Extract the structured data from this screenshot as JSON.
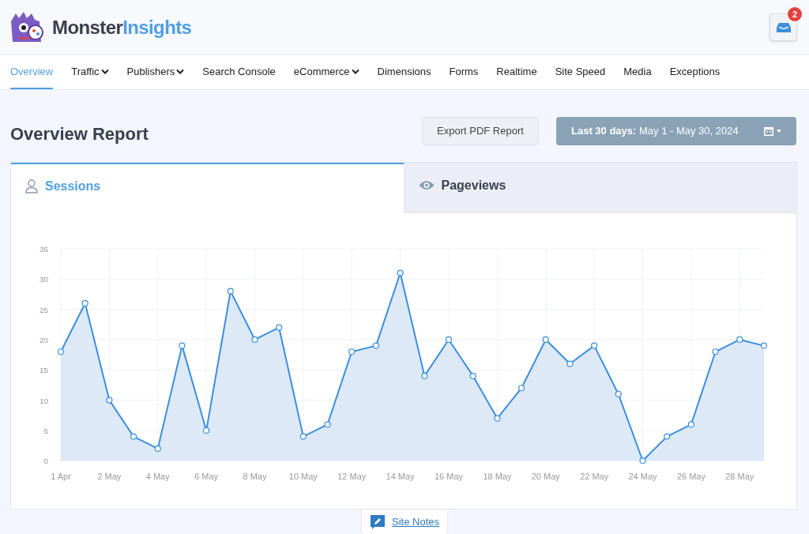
{
  "header": {
    "logo": {
      "first": "Monster",
      "second": "Insights"
    },
    "notifications": {
      "count": "2"
    }
  },
  "nav": [
    {
      "label": "Overview",
      "selected": true,
      "dropdown": false
    },
    {
      "label": "Traffic",
      "selected": false,
      "dropdown": true
    },
    {
      "label": "Publishers",
      "selected": false,
      "dropdown": true
    },
    {
      "label": "Search Console",
      "selected": false,
      "dropdown": false
    },
    {
      "label": "eCommerce",
      "selected": false,
      "dropdown": true
    },
    {
      "label": "Dimensions",
      "selected": false,
      "dropdown": false
    },
    {
      "label": "Forms",
      "selected": false,
      "dropdown": false
    },
    {
      "label": "Realtime",
      "selected": false,
      "dropdown": false
    },
    {
      "label": "Site Speed",
      "selected": false,
      "dropdown": false
    },
    {
      "label": "Media",
      "selected": false,
      "dropdown": false
    },
    {
      "label": "Exceptions",
      "selected": false,
      "dropdown": false
    }
  ],
  "report": {
    "title": "Overview Report",
    "export_button": "Export PDF Report",
    "date_range": "**Last 30 days:** May 1 - May 30, 2024"
  },
  "tabs": [
    {
      "label": "Sessions",
      "kind": "user",
      "selected": true
    },
    {
      "label": "Pageviews",
      "kind": "eye",
      "selected": false
    }
  ],
  "chart_data": {
    "type": "area",
    "ylim": [
      0,
      35
    ],
    "yticks": [
      0,
      5,
      10,
      15,
      20,
      25,
      30,
      35
    ],
    "grid": true,
    "categories": [
      "1 Apr",
      null,
      "2 May",
      null,
      "4 May",
      null,
      "6 May",
      null,
      "8 May",
      null,
      "10 May",
      null,
      "12 May",
      null,
      "14 May",
      null,
      "16 May",
      null,
      "18 May",
      null,
      "20 May",
      null,
      "22 May",
      null,
      "24 May",
      null,
      "26 May",
      null,
      "28 May",
      null
    ],
    "series": [
      {
        "color": "#3b8fdc",
        "values": [
          18,
          26,
          10,
          4,
          2,
          19,
          5,
          28,
          20,
          22,
          4,
          6,
          18,
          19,
          31,
          14,
          20,
          14,
          7,
          12,
          20,
          16,
          19,
          11,
          0,
          4,
          6,
          18,
          20,
          19
        ]
      }
    ]
  },
  "site_notes": {
    "label": "Site Notes"
  }
}
